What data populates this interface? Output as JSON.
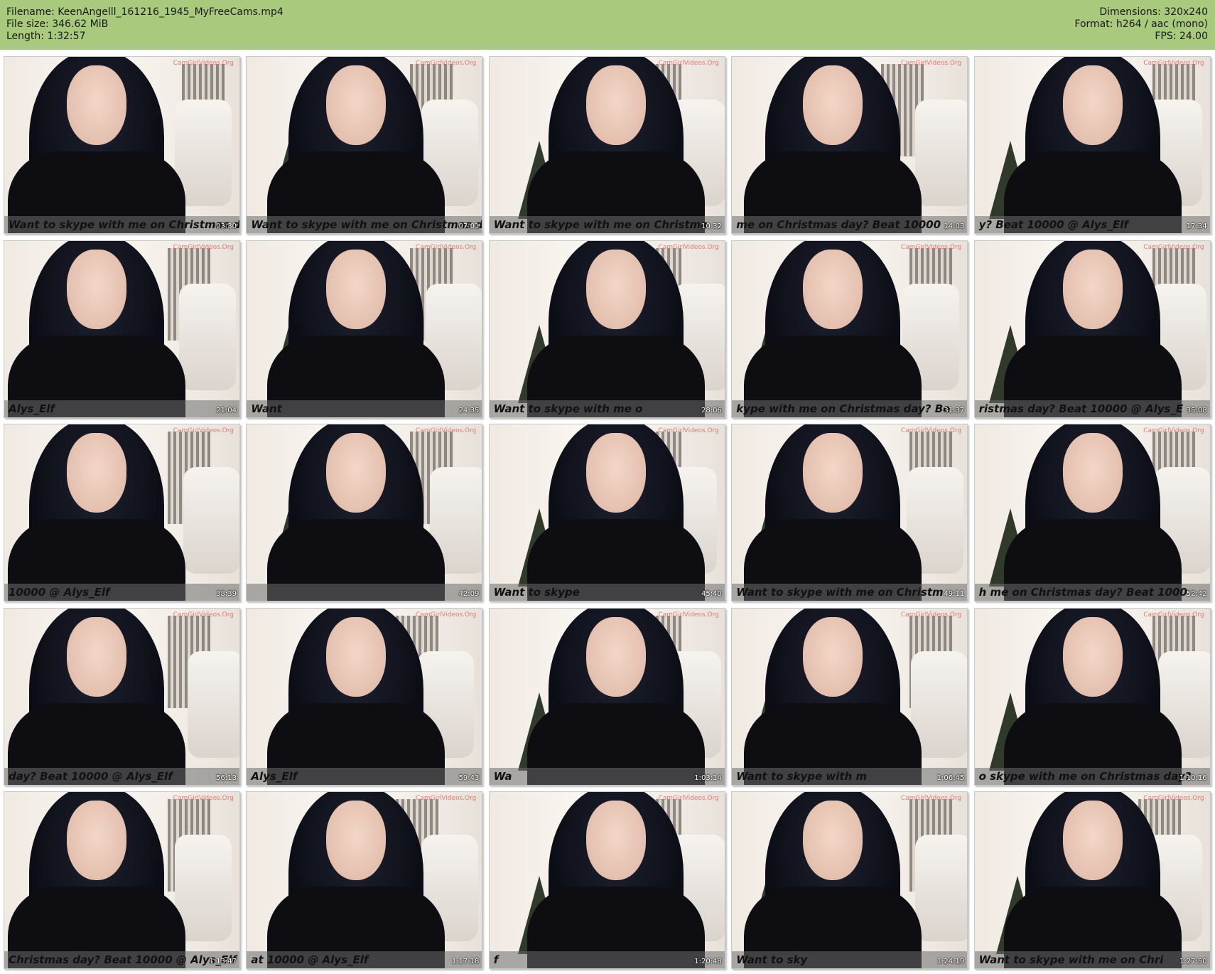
{
  "header": {
    "filename": "Filename: KeenAngelll_161216_1945_MyFreeCams.mp4",
    "file_size": "File size: 346.62 MiB",
    "length": "Length: 1:32:57",
    "dimensions": "Dimensions: 320x240",
    "format": "Format: h264 / aac (mono)",
    "fps": "FPS: 24.00"
  },
  "watermark": "CamGirlVideos.Org",
  "thumbnails": [
    {
      "time": "03:30",
      "caption": "Want to skype with me on Christmas day?"
    },
    {
      "time": "07:01",
      "caption": "Want to skype with me on Christmas d"
    },
    {
      "time": "10:32",
      "caption": "Want to skype with me on Christma"
    },
    {
      "time": "14:03",
      "caption": "me on Christmas day? Beat 10000"
    },
    {
      "time": "17:34",
      "caption": "y? Beat 10000 @ Alys_Elf"
    },
    {
      "time": "21:04",
      "caption": "Alys_Elf"
    },
    {
      "time": "24:35",
      "caption": "Want"
    },
    {
      "time": "28:06",
      "caption": "Want to skype with me o"
    },
    {
      "time": "31:37",
      "caption": "kype with me on Christmas day? Be"
    },
    {
      "time": "35:08",
      "caption": "ristmas day? Beat 10000 @ Alys_E"
    },
    {
      "time": "38:39",
      "caption": "10000 @ Alys_Elf"
    },
    {
      "time": "42:09",
      "caption": ""
    },
    {
      "time": "45:40",
      "caption": "Want to skype"
    },
    {
      "time": "49:11",
      "caption": "Want to skype with me on Christm"
    },
    {
      "time": "52:42",
      "caption": "h me on Christmas day? Beat 1000"
    },
    {
      "time": "56:13",
      "caption": "day? Beat 10000 @ Alys_Elf"
    },
    {
      "time": "59:43",
      "caption": "Alys_Elf"
    },
    {
      "time": "1:03:14",
      "caption": "Wa"
    },
    {
      "time": "1:06:45",
      "caption": "Want to skype with m"
    },
    {
      "time": "1:10:16",
      "caption": "o skype with me on Christmas day?"
    },
    {
      "time": "1:13:47",
      "caption": "Christmas day? Beat 10000 @ Alys_Elf"
    },
    {
      "time": "1:17:18",
      "caption": "at 10000 @ Alys_Elf"
    },
    {
      "time": "1:20:48",
      "caption": "f"
    },
    {
      "time": "1:24:19",
      "caption": "Want to sky"
    },
    {
      "time": "1:27:50",
      "caption": "Want to skype with me on Chri"
    }
  ]
}
